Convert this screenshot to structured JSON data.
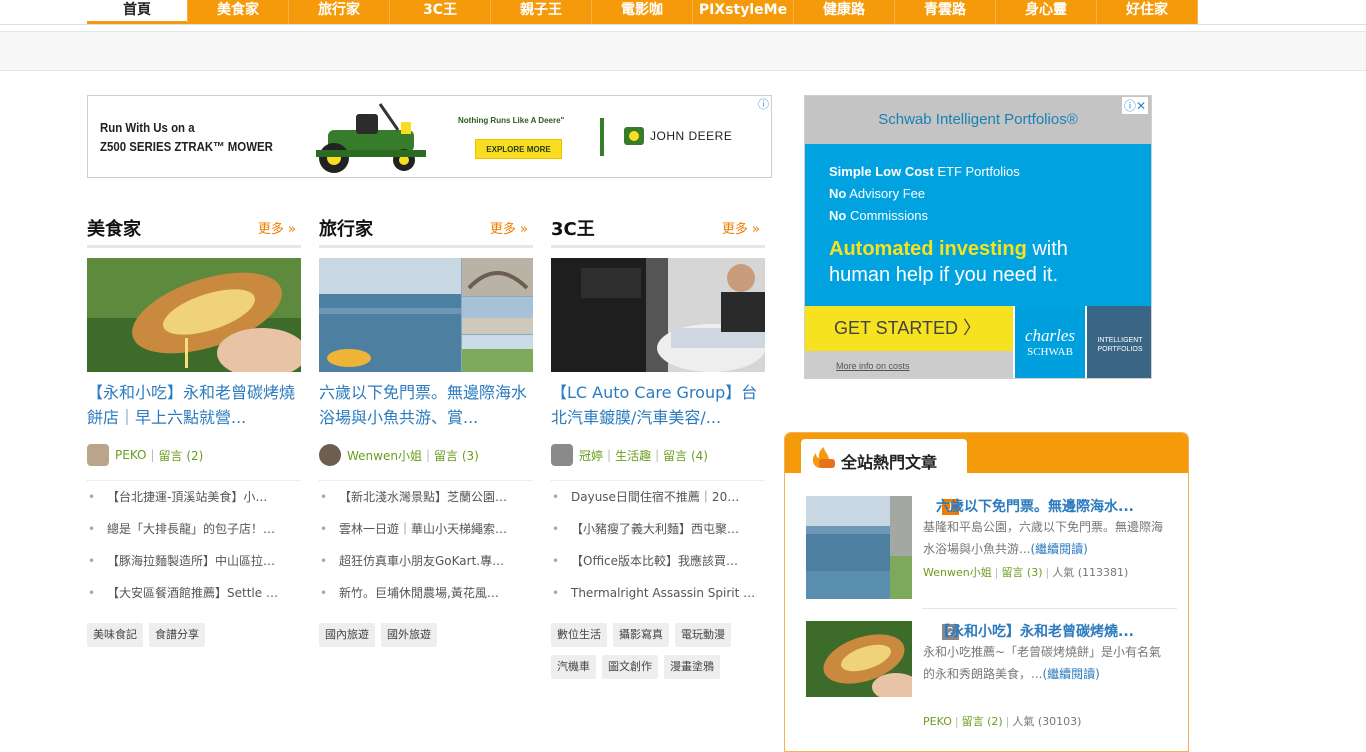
{
  "nav": {
    "items": [
      "首頁",
      "美食家",
      "旅行家",
      "3C王",
      "親子王",
      "電影咖",
      "PIXstyleMe",
      "健康路",
      "青雲路",
      "身心靈",
      "好住家"
    ],
    "active": "首頁",
    "accent": "#f59b0b"
  },
  "top_ad": {
    "line1": "Run With Us on a",
    "line2": "Z500 SERIES ZTRAK™ MOWER",
    "tagline": "Nothing Runs Like A Deere\"",
    "button": "EXPLORE MORE",
    "brand": "JOHN DEERE",
    "info_icon": "info-icon"
  },
  "columns": [
    {
      "title": "美食家",
      "more": "更多 »",
      "headline": "【永和小吃】永和老曾碳烤燒餅店｜早上六點就營...",
      "author": "PEKO",
      "sep": "|",
      "comments": "留言 (2)",
      "category": "",
      "list": [
        "【台北捷運-頂溪站美食】小…",
        "總是「大排長龍」的包子店！…",
        "【豚海拉麵製造所】中山區拉…",
        "【大安區餐酒館推薦】Settle …"
      ],
      "tags": [
        "美味食記",
        "食譜分享"
      ]
    },
    {
      "title": "旅行家",
      "more": "更多 »",
      "headline": "六歲以下免門票。無邊際海水浴場與小魚共游、賞...",
      "author": "Wenwen小姐",
      "sep": "|",
      "comments": "留言 (3)",
      "category": "",
      "list": [
        "【新北淺水灣景點】芝蘭公園…",
        "雲林一日遊｜華山小天梯繩索…",
        "超狂仿真車小朋友GoKart.專…",
        "新竹。巨埔休閒農場,黃花風…"
      ],
      "tags": [
        "國內旅遊",
        "國外旅遊"
      ]
    },
    {
      "title": "3C王",
      "more": "更多 »",
      "headline": "【LC Auto Care Group】台北汽車鍍膜/汽車美容/...",
      "author": "冠婷",
      "sep": "|",
      "comments": "留言 (4)",
      "category": "生活趣",
      "list": [
        "Dayuse日間住宿不推薦｜20…",
        "【小豬瘦了義大利麵】西屯聚…",
        "【Office版本比較】我應該買…",
        "Thermalright Assassin Spirit …"
      ],
      "tags": [
        "數位生活",
        "攝影寫真",
        "電玩動漫",
        "汽機車",
        "圖文創作",
        "漫畫塗鴉"
      ]
    }
  ],
  "right_ad": {
    "header": "Schwab Intelligent Portfolios®",
    "line1_bold": "Simple Low Cost",
    "line1_rest": " ETF Portfolios",
    "line2_bold": "No",
    "line2_rest": " Advisory Fee",
    "line3_bold": "No",
    "line3_rest": " Commissions",
    "big1_bold": "Automated investing",
    "big1_rest": " with",
    "big2": "human help if you need it.",
    "cta": "GET STARTED 〉",
    "more_info": "More info on costs",
    "brand1": "charles",
    "brand2": "SCHWAB",
    "ip1": "INTELLIGENT",
    "ip2": "PORTFOLIOS",
    "close": "ⓘ✕"
  },
  "hot": {
    "title": "全站熱門文章",
    "items": [
      {
        "rank": "1",
        "title": "六歲以下免門票。無邊際海水...",
        "desc": "基隆和平島公園，六歲以下免門票。無邊際海水浴場與小魚共游...",
        "more": "(繼續閱讀)",
        "author": "Wenwen小姐",
        "sep": "|",
        "comments": "留言 (3)",
        "views": "人氣 (113381)",
        "badge_color": "#f07c00"
      },
      {
        "rank": "2",
        "title": "【永和小吃】永和老曾碳烤燒...",
        "desc": "永和小吃推薦~「老曾碳烤燒餅」是小有名氣的永和秀朗路美食，...",
        "more": "(繼續閱讀)",
        "author": "PEKO",
        "sep": "|",
        "comments": "留言 (2)",
        "views": "人氣 (30103)",
        "badge_color": "#888888"
      }
    ]
  }
}
